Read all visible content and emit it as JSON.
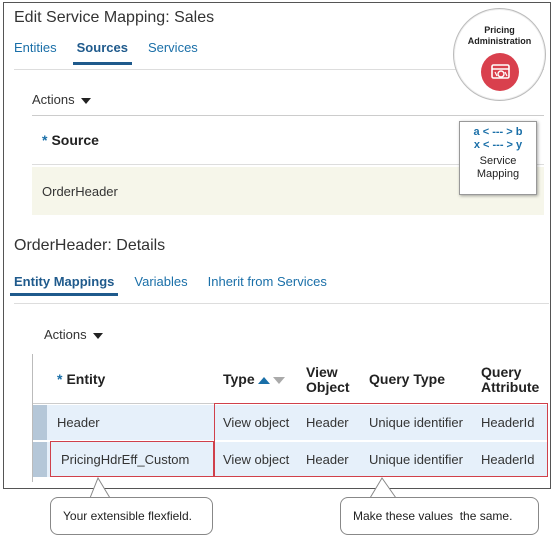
{
  "page": {
    "title": "Edit Service Mapping: Sales",
    "tabs": [
      "Entities",
      "Sources",
      "Services"
    ],
    "active_tab": "Sources"
  },
  "sources": {
    "actions_label": "Actions",
    "column_header": "Source",
    "rows": [
      "OrderHeader"
    ]
  },
  "details": {
    "title": "OrderHeader: Details",
    "tabs": [
      "Entity Mappings",
      "Variables",
      "Inherit from Services"
    ],
    "active_tab": "Entity Mappings",
    "actions_label": "Actions",
    "columns": {
      "entity": "Entity",
      "type": "Type",
      "view_object_line1": "View",
      "view_object_line2": "Object",
      "query_type": "Query Type",
      "query_attribute_line1": "Query",
      "query_attribute_line2": "Attribute"
    },
    "rows": [
      {
        "entity": "Header",
        "type": "View object",
        "view_object": "Header",
        "query_type": "Unique identifier",
        "query_attribute": "HeaderId"
      },
      {
        "entity": "PricingHdrEff_Custom",
        "type": "View object",
        "view_object": "Header",
        "query_type": "Unique identifier",
        "query_attribute": "HeaderId"
      }
    ]
  },
  "badge": {
    "line1": "Pricing",
    "line2": "Administration",
    "icon": "pricing-admin-icon",
    "color": "#d9404d"
  },
  "service_mapping_icon": {
    "line1": "a < --- > b",
    "line2": "x < --- > y",
    "label_line1": "Service",
    "label_line2": "Mapping"
  },
  "callouts": {
    "left": "Your extensible flexfield.",
    "right": "Make these values  the same."
  },
  "colors": {
    "accent": "#1a6fa8",
    "highlight": "#d0404a",
    "selected_row": "#e6f0fa",
    "source_row": "#f6f6ea"
  }
}
